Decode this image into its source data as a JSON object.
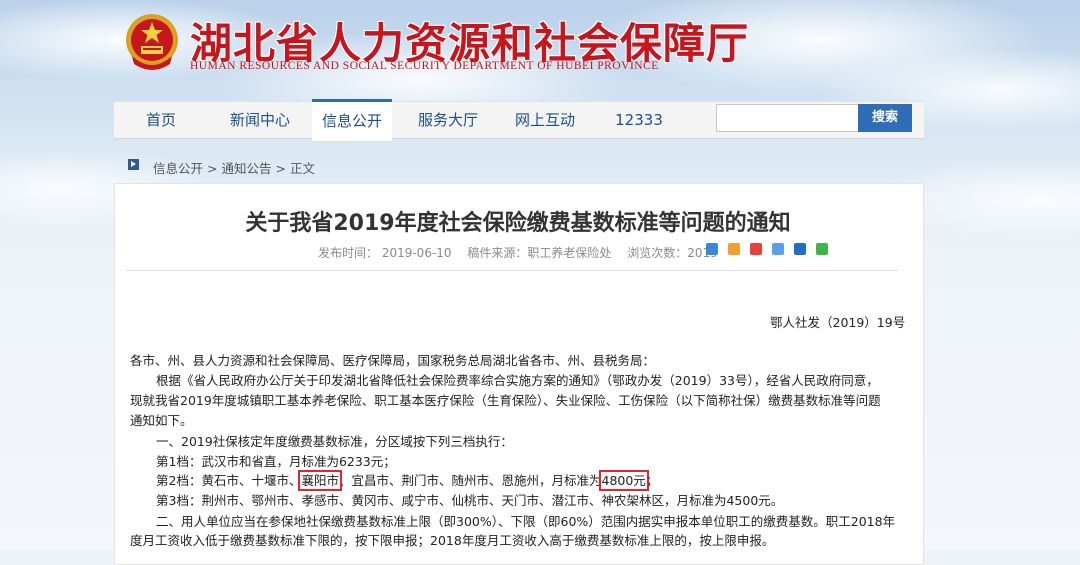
{
  "header": {
    "title": "湖北省人力资源和社会保障厅",
    "subtitle": "HUMAN RESOURCES AND SOCIAL SECURITY DEPARTMENT OF HUBEI PROVINCE"
  },
  "nav": {
    "items": [
      {
        "label": "首页"
      },
      {
        "label": "新闻中心"
      },
      {
        "label": "信息公开",
        "active": true
      },
      {
        "label": "服务大厅"
      },
      {
        "label": "网上互动"
      },
      {
        "label": "12333"
      }
    ],
    "search_value": "",
    "search_button": "搜索"
  },
  "breadcrumb": {
    "items": [
      "信息公开",
      "通知公告",
      "正文"
    ],
    "separator": ">"
  },
  "article": {
    "title": "关于我省2019年度社会保险缴费基数标准等问题的通知",
    "meta": {
      "published": "发布时间： 2019-06-10",
      "source": "稿件来源：职工养老保险处",
      "views": "浏览次数：2019"
    },
    "doc_number": "鄂人社发（2019）19号",
    "paragraphs": {
      "salutation": "各市、州、县人力资源和社会保障局、医疗保障局，国家税务总局湖北省各市、州、县税务局：",
      "intro_1": "根据《省人民政府办公厅关于印发湖北省降低社会保险费率综合实施方案的通知》（鄂政办发（2019）33号），经省人民政府同意，",
      "intro_2": "现就我省2019年度城镇职工基本养老保险、职工基本医疗保险（生育保险）、失业保险、工伤保险（以下简称社保）缴费基数标准等问题",
      "intro_3": "通知如下。",
      "section_1": "一、2019社保核定年度缴费基数标准，分区域按下列三档执行：",
      "tier_1": "第1档：武汉市和省直，月标准为6233元；",
      "tier_2_a": "第2档：黄石市、十堰市、",
      "tier_2_city": "襄阳市",
      "tier_2_b": "、宜昌市、荆门市、随州市、恩施州，月标准为",
      "tier_2_amount": "4800元",
      "tier_2_end": "；",
      "tier_3": "第3档：荆州市、鄂州市、孝感市、黄冈市、咸宁市、仙桃市、天门市、潜江市、神农架林区，月标准为4500元。",
      "section_2_a": "二、用人单位应当在参保地社保缴费基数标准上限（即300%）、下限（即60%）范围内据实申报本单位职工的缴费基数。职工2018年",
      "section_2_b": "度月工资收入低于缴费基数标准下限的，按下限申报；2018年度月工资收入高于缴费基数标准上限的，按上限申报。"
    }
  },
  "share_icons": [
    "qzone-share-icon",
    "tencent-share-icon",
    "sina-weibo-share-icon",
    "pengyou-share-icon",
    "renren-share-icon",
    "wechat-share-icon"
  ],
  "colors": {
    "brand_red": "#c4161c",
    "nav_blue": "#1b4f8c",
    "button_blue": "#2f6db6",
    "highlight_red": "#e0252b"
  }
}
